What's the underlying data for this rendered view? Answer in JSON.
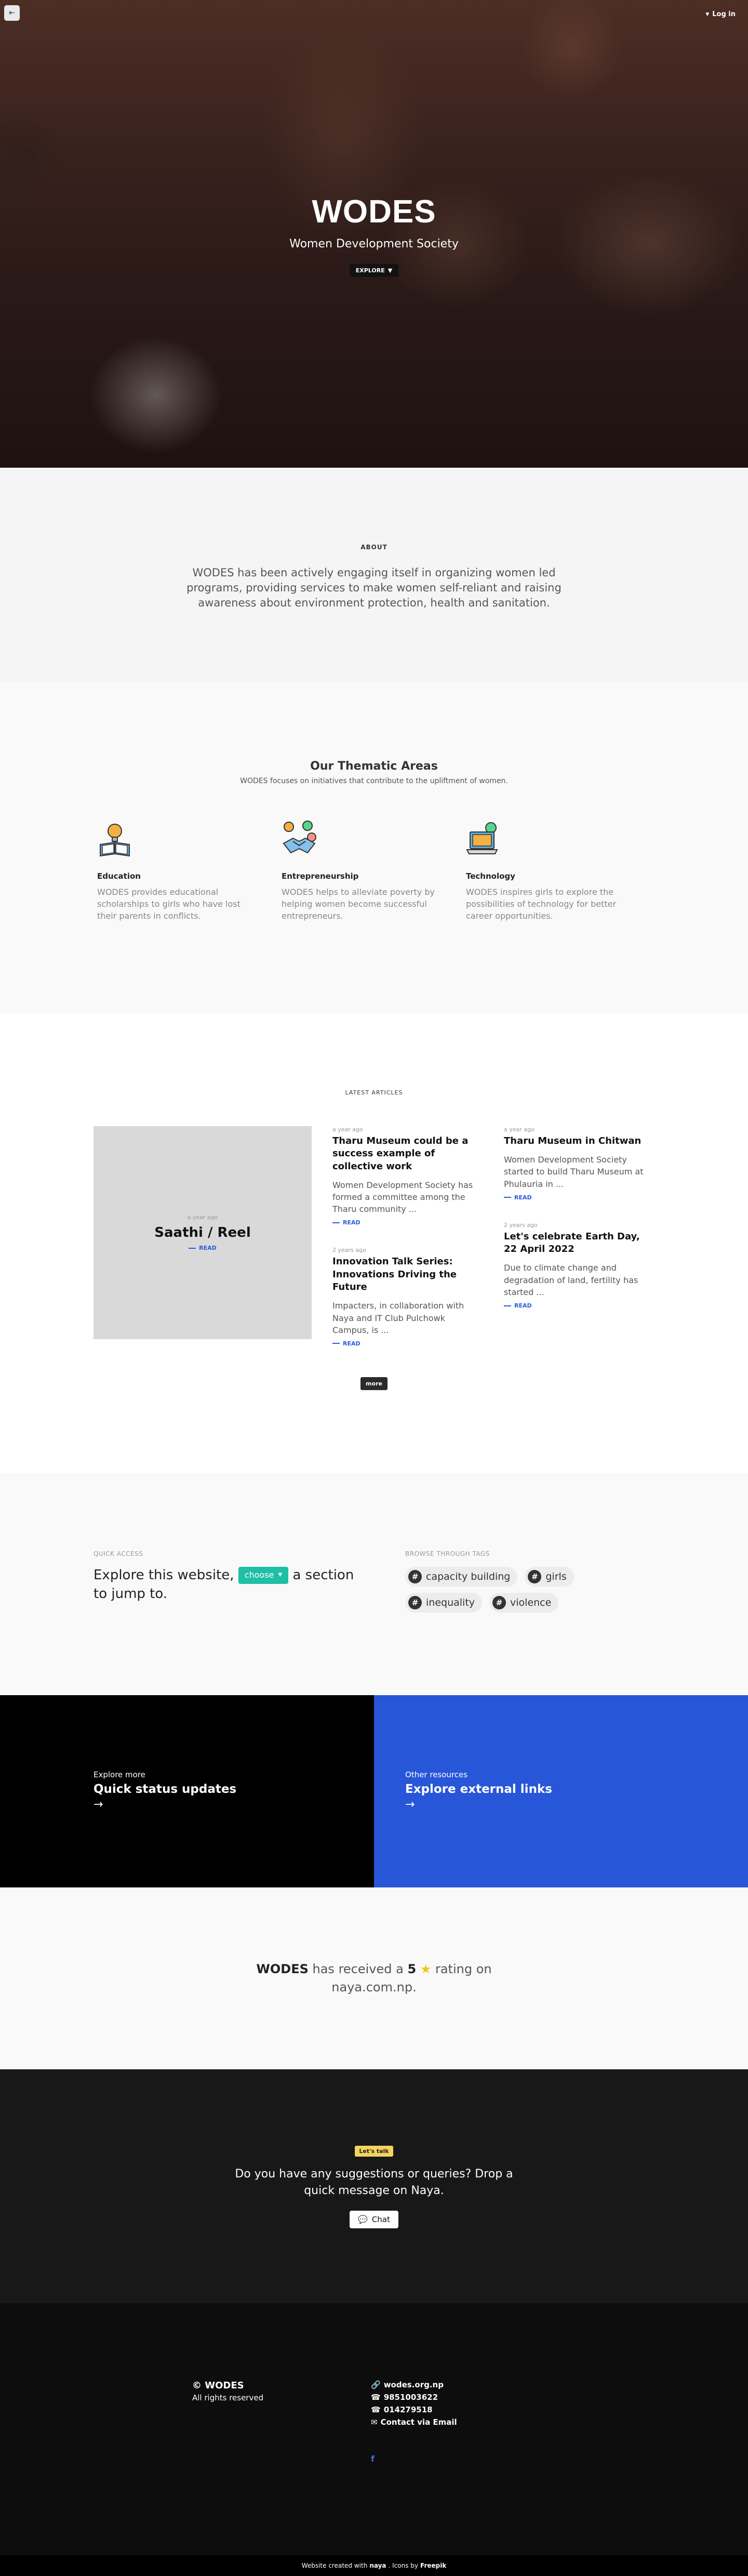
{
  "header": {
    "menu_icon": "back-arrow-icon",
    "login_label": "Log in"
  },
  "hero": {
    "title": "WODES",
    "subtitle": "Women Development Society",
    "explore_label": "EXPLORE"
  },
  "about": {
    "kicker": "ABOUT",
    "text": "WODES has been actively engaging itself in organizing women led programs, providing services to make women self-reliant and raising awareness about environment protection, health and sanitation."
  },
  "thematic": {
    "title": "Our Thematic Areas",
    "lead": "WODES focuses on initiatives that contribute to the upliftment of women.",
    "areas": [
      {
        "icon": "book-bulb-icon",
        "title": "Education",
        "text": "WODES provides educational scholarships to girls who have lost their parents in conflicts."
      },
      {
        "icon": "handshake-icon",
        "title": "Entrepreneurship",
        "text": "WODES helps to alleviate poverty by helping women become successful entrepreneurs."
      },
      {
        "icon": "laptop-icon",
        "title": "Technology",
        "text": "WODES inspires girls to explore the possibilities of technology for better career opportunities."
      }
    ]
  },
  "articles": {
    "kicker": "LATEST ARTICLES",
    "read_label": "READ",
    "more_label": "more",
    "feature": {
      "age": "a year ago",
      "title": "Saathi / Reel"
    },
    "cards": [
      {
        "age": "a year ago",
        "title": "Tharu Museum could be a success example of collective work",
        "text": "Women Development Society has formed a committee among the Tharu community ..."
      },
      {
        "age": "a year ago",
        "title": "Tharu Museum in Chitwan",
        "text": "Women Development Society started to build Tharu Museum at Phulauria in ..."
      },
      {
        "age": "2 years ago",
        "title": "Innovation Talk Series: Innovations Driving the Future",
        "text": "Impacters, in collaboration with Naya and IT Club Pulchowk Campus, is ..."
      },
      {
        "age": "2 years ago",
        "title": "Let's celebrate Earth Day, 22 April 2022",
        "text": "Due to climate change and degradation of land, fertility has started ..."
      }
    ]
  },
  "quick": {
    "kicker": "QUICK ACCESS",
    "statement_before": "Explore this website,",
    "choose_label": "choose",
    "statement_after": "a section to jump to.",
    "tags_kicker": "BROWSE THROUGH TAGS",
    "tags": [
      "capacity building",
      "girls",
      "inequality",
      "violence"
    ]
  },
  "panels": {
    "left": {
      "small": "Explore more",
      "big": "Quick status updates",
      "arrow": "→"
    },
    "right": {
      "small": "Other resources",
      "big": "Explore external links",
      "arrow": "→"
    }
  },
  "rating": {
    "brand": "WODES",
    "text_mid": "has received a",
    "score": "5",
    "star": "★",
    "text_end": "rating on naya.com.np."
  },
  "contact": {
    "badge": "Let's talk",
    "question": "Do you have any suggestions or queries? Drop a quick message on Naya.",
    "chat_label": "Chat"
  },
  "footer": {
    "brand": "© WODES",
    "rights": "All rights reserved",
    "links": [
      {
        "icon": "link-icon",
        "text": "wodes.org.np"
      },
      {
        "icon": "phone-icon",
        "text": "9851003622"
      },
      {
        "icon": "phone-icon",
        "text": "014279518"
      },
      {
        "icon": "mail-icon",
        "text": "Contact via Email"
      }
    ],
    "social_icon": "facebook-icon"
  },
  "credit": {
    "prefix": "Website created with",
    "naya": "naya",
    "middle": ". Icons by",
    "freepik": "Freepik"
  }
}
